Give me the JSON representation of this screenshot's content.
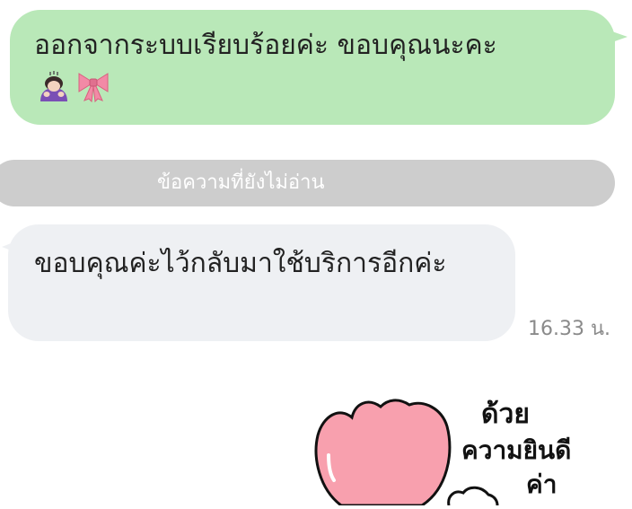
{
  "messages": {
    "outgoing": {
      "text": "ออกจากระบบเรียบร้อยค่ะ ขอบคุณนะคะ",
      "emojis": [
        "woman-bowing-emoji",
        "ribbon-emoji"
      ]
    },
    "unread_divider": "ข้อความที่ยังไม่อ่าน",
    "incoming": {
      "text": "ขอบคุณค่ะไว้กลับมาใช้บริการอีกค่ะ",
      "time": "16.33 น."
    },
    "sticker": {
      "lines": [
        "ด้วย",
        "ความยินดี",
        "ค่า"
      ]
    }
  },
  "colors": {
    "outgoing_bubble": "#b9e8b8",
    "incoming_bubble": "#eef0f3",
    "divider": "#cdcdcd",
    "sticker_pink": "#f8a0ae"
  }
}
